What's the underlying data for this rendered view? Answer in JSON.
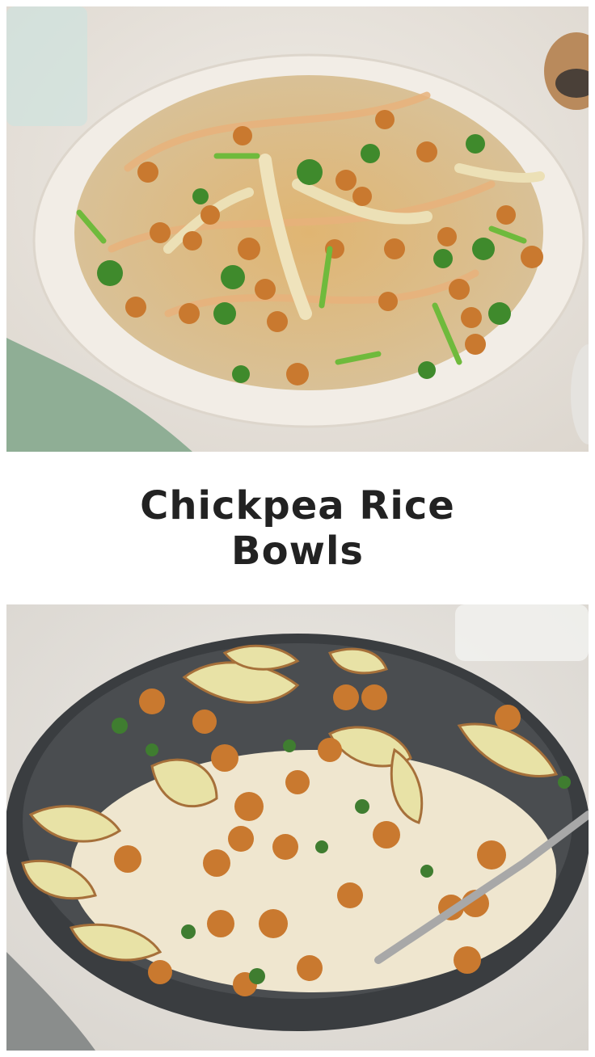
{
  "title": "Chickpea Rice Bowls",
  "images": {
    "top": {
      "subject": "rice-bowl-with-chickpeas-cabbage-and-sauce-icon",
      "bowl_color": "#f2ede6",
      "background_color": "#ebe6df"
    },
    "bottom": {
      "subject": "dark-bowl-with-rice-chickpeas-and-roasted-cabbage-icon",
      "bowl_color": "#3a3d40",
      "background_color": "#e4e1dc"
    }
  },
  "colors": {
    "title_text": "#222222",
    "chickpea": "#c9792f",
    "herb": "#3f8a2c",
    "rice": "#efe6cf"
  }
}
